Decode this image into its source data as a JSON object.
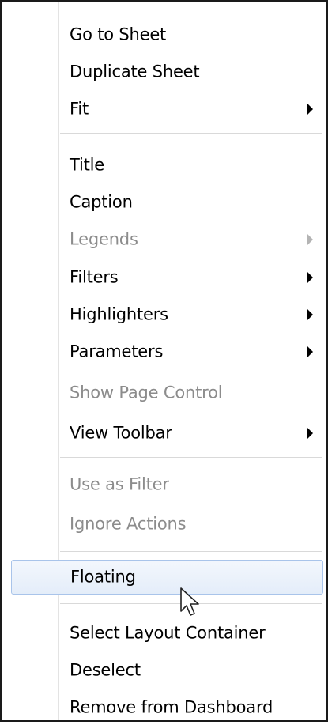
{
  "menu": {
    "go_to_sheet": "Go to Sheet",
    "duplicate_sheet": "Duplicate Sheet",
    "fit": "Fit",
    "title": "Title",
    "caption": "Caption",
    "legends": "Legends",
    "filters": "Filters",
    "highlighters": "Highlighters",
    "parameters": "Parameters",
    "show_page_control": "Show Page Control",
    "view_toolbar": "View Toolbar",
    "use_as_filter": "Use as Filter",
    "ignore_actions": "Ignore Actions",
    "floating": "Floating",
    "select_layout_container": "Select Layout Container",
    "deselect": "Deselect",
    "remove_from_dashboard": "Remove from Dashboard"
  },
  "colors": {
    "disabled_text": "#8c8c8c",
    "hover_border": "#a9c4ea",
    "hover_fill": "#e4edf9"
  },
  "icons": {
    "submenu": "triangle-right",
    "pointer": "mouse-arrow-cursor"
  }
}
